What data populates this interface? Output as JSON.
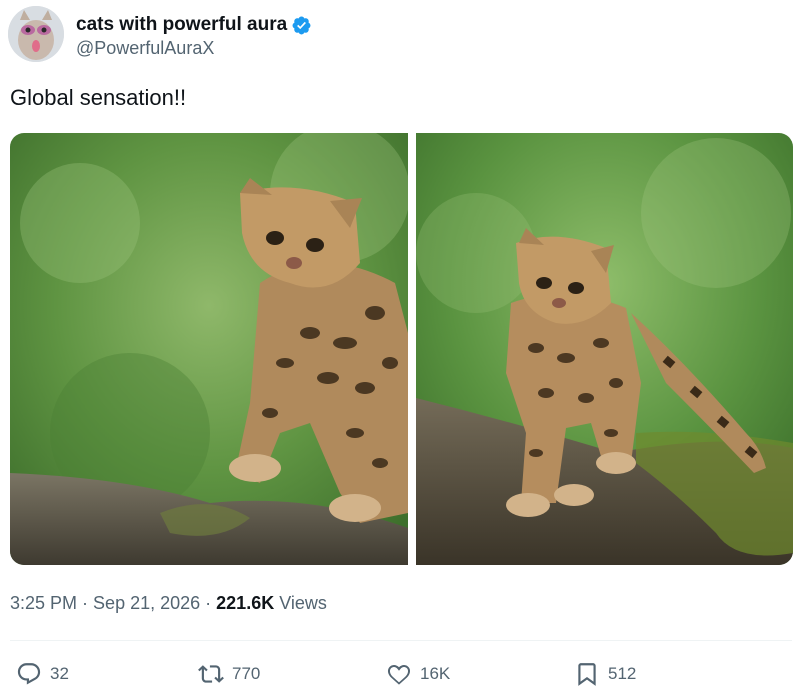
{
  "author": {
    "display_name": "cats with powerful aura",
    "handle": "@PowerfulAuraX",
    "verified_icon": "verified-badge-icon",
    "verified_color": "#1d9bf0"
  },
  "tweet": {
    "text": "Global sensation!!"
  },
  "meta": {
    "time": "3:25 PM",
    "sep1": " · ",
    "date": "Sep 21, 2026",
    "sep2": " · ",
    "views_count": "221.6K",
    "views_label": " Views"
  },
  "actions": {
    "replies": "32",
    "reposts": "770",
    "likes": "16K",
    "bookmarks": "512"
  },
  "icons": {
    "reply": "reply-icon",
    "repost": "repost-icon",
    "like": "like-icon",
    "bookmark": "bookmark-icon"
  }
}
